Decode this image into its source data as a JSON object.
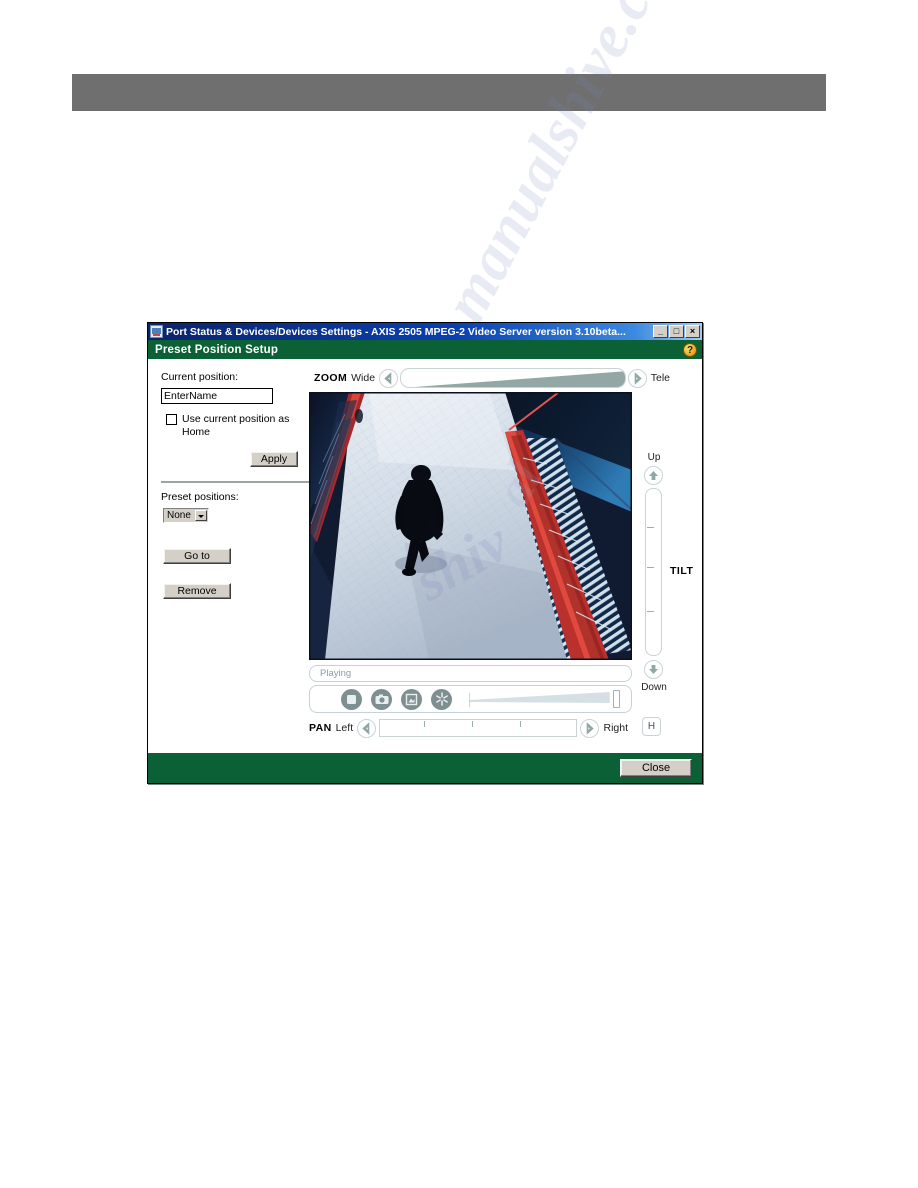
{
  "page": {
    "watermark_text_1": "manualshive.com",
    "watermark_text_2": "manualshive.com"
  },
  "window": {
    "title": "Port Status & Devices/Devices Settings - AXIS 2505 MPEG-2 Video Server version 3.10beta...",
    "icon": "app-icon",
    "minimize_label": "_",
    "maximize_label": "□",
    "close_label": "×"
  },
  "section": {
    "title": "Preset Position Setup",
    "help_label": "?"
  },
  "left_panel": {
    "current_position_label": "Current position:",
    "name_value": "EnterName",
    "name_placeholder": "EnterName",
    "home_checkbox_label": "Use current position as Home",
    "home_checkbox_checked": false,
    "apply_label": "Apply",
    "preset_positions_label": "Preset positions:",
    "preset_selected": "None",
    "preset_options": [
      "None"
    ],
    "goto_label": "Go to",
    "remove_label": "Remove"
  },
  "zoom_control": {
    "name": "ZOOM",
    "min_label": "Wide",
    "max_label": "Tele",
    "left_arrow": "arrow-left-icon",
    "right_arrow": "arrow-right-icon",
    "value_percent": 100
  },
  "tilt_control": {
    "name": "TILT",
    "up_label": "Up",
    "down_label": "Down",
    "up_arrow": "arrow-up-icon",
    "down_arrow": "arrow-down-icon"
  },
  "pan_control": {
    "name": "PAN",
    "left_label": "Left",
    "right_label": "Right",
    "left_arrow": "arrow-left-icon",
    "right_arrow": "arrow-right-icon",
    "home_label": "H"
  },
  "player": {
    "status": "Playing",
    "buttons": [
      {
        "name": "stop-button",
        "icon": "stop-square-icon"
      },
      {
        "name": "snapshot-button",
        "icon": "camera-icon"
      },
      {
        "name": "image-button",
        "icon": "picture-icon"
      },
      {
        "name": "settings-button",
        "icon": "snowflake-icon"
      }
    ],
    "volume_percent": 100
  },
  "footer": {
    "close_label": "Close"
  },
  "colors": {
    "titlebar_blue": "#0a246a",
    "section_green": "#0b6135",
    "dialog_face": "#d4d0c8",
    "band_gray": "#6f6f6f",
    "slider_wedge": "#8fa3a0",
    "tool_button": "#7e8f91",
    "help_yellow": "#e8a21c"
  }
}
